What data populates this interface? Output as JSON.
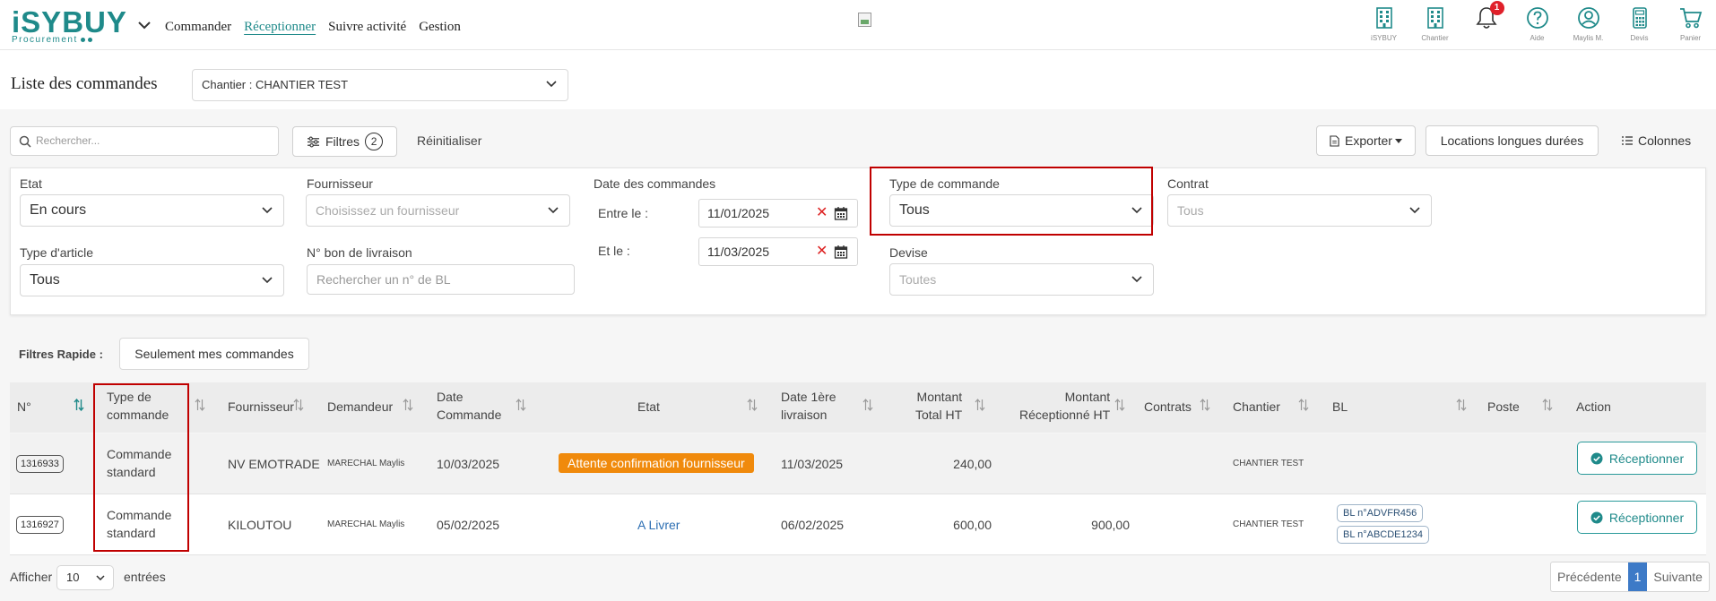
{
  "nav": {
    "logo_main": "iSYBUY",
    "logo_sub": "Procurement",
    "menu": [
      "Commander",
      "Réceptionner",
      "Suivre activité",
      "Gestion"
    ],
    "active_menu": "Réceptionner",
    "icons": [
      {
        "icon": "building-icon",
        "label": "iSYBUY"
      },
      {
        "icon": "building-icon",
        "label": "Chantier"
      },
      {
        "icon": "bell-icon",
        "label": "",
        "badge": "1"
      },
      {
        "icon": "help-icon",
        "label": "Aide"
      },
      {
        "icon": "user-icon",
        "label": "Maylis M."
      },
      {
        "icon": "calculator-icon",
        "label": "Devis"
      },
      {
        "icon": "cart-icon",
        "label": "Panier"
      }
    ]
  },
  "page": {
    "title": "Liste des commandes",
    "chantier_select": "Chantier : CHANTIER TEST"
  },
  "toolbar": {
    "search_placeholder": "Rechercher...",
    "filters_label": "Filtres",
    "filters_count": "2",
    "reset_label": "Réinitialiser",
    "export_label": "Exporter",
    "long_rentals_label": "Locations longues durées",
    "columns_label": "Colonnes"
  },
  "filters": {
    "etat_label": "Etat",
    "etat_value": "En cours",
    "fournisseur_label": "Fournisseur",
    "fournisseur_placeholder": "Choisissez un fournisseur",
    "date_label": "Date des commandes",
    "date_from_label": "Entre le :",
    "date_from": "11/01/2025",
    "date_to_label": "Et le :",
    "date_to": "11/03/2025",
    "type_commande_label": "Type de commande",
    "type_commande_value": "Tous",
    "contrat_label": "Contrat",
    "contrat_value": "Tous",
    "type_article_label": "Type d'article",
    "type_article_value": "Tous",
    "bl_label": "N° bon de livraison",
    "bl_placeholder": "Rechercher un n° de BL",
    "devise_label": "Devise",
    "devise_value": "Toutes"
  },
  "quick_filters": {
    "label": "Filtres Rapide :",
    "mine_label": "Seulement mes commandes"
  },
  "table": {
    "headers": {
      "num": "N°",
      "type_l1": "Type de",
      "type_l2": "commande",
      "fournisseur": "Fournisseur",
      "demandeur": "Demandeur",
      "date_l1": "Date",
      "date_l2": "Commande",
      "etat": "Etat",
      "livr_l1": "Date 1ère",
      "livr_l2": "livraison",
      "mt_l1": "Montant",
      "mt_l2": "Total HT",
      "mr_l1": "Montant",
      "mr_l2": "Réceptionné HT",
      "contrats": "Contrats",
      "chantier": "Chantier",
      "bl": "BL",
      "poste": "Poste",
      "action": "Action"
    },
    "rows": [
      {
        "num": "1316933",
        "type_l1": "Commande",
        "type_l2": "standard",
        "fournisseur": "NV EMOTRADE",
        "demandeur": "MARECHAL Maylis",
        "date": "10/03/2025",
        "etat": "Attente confirmation fournisseur",
        "livraison": "11/03/2025",
        "montant_total": "240,00",
        "montant_recu": "",
        "chantier": "CHANTIER TEST",
        "bl": [],
        "action": "Réceptionner"
      },
      {
        "num": "1316927",
        "type_l1": "Commande",
        "type_l2": "standard",
        "fournisseur": "KILOUTOU",
        "demandeur": "MARECHAL Maylis",
        "date": "05/02/2025",
        "etat": "A Livrer",
        "livraison": "06/02/2025",
        "montant_total": "600,00",
        "montant_recu": "900,00",
        "chantier": "CHANTIER TEST",
        "bl": [
          "BL n°ADVFR456",
          "BL n°ABCDE1234"
        ],
        "action": "Réceptionner"
      }
    ]
  },
  "footer": {
    "show_label": "Afficher",
    "page_length": "10",
    "entries_label": "entrées",
    "prev": "Précédente",
    "current": "1",
    "next": "Suivante"
  },
  "colors": {
    "brand": "#1f8a8a",
    "highlight_box": "#c00000",
    "status_orange": "#f08a0c",
    "link_blue": "#2d6fb3",
    "badge_red": "#e0202a"
  }
}
